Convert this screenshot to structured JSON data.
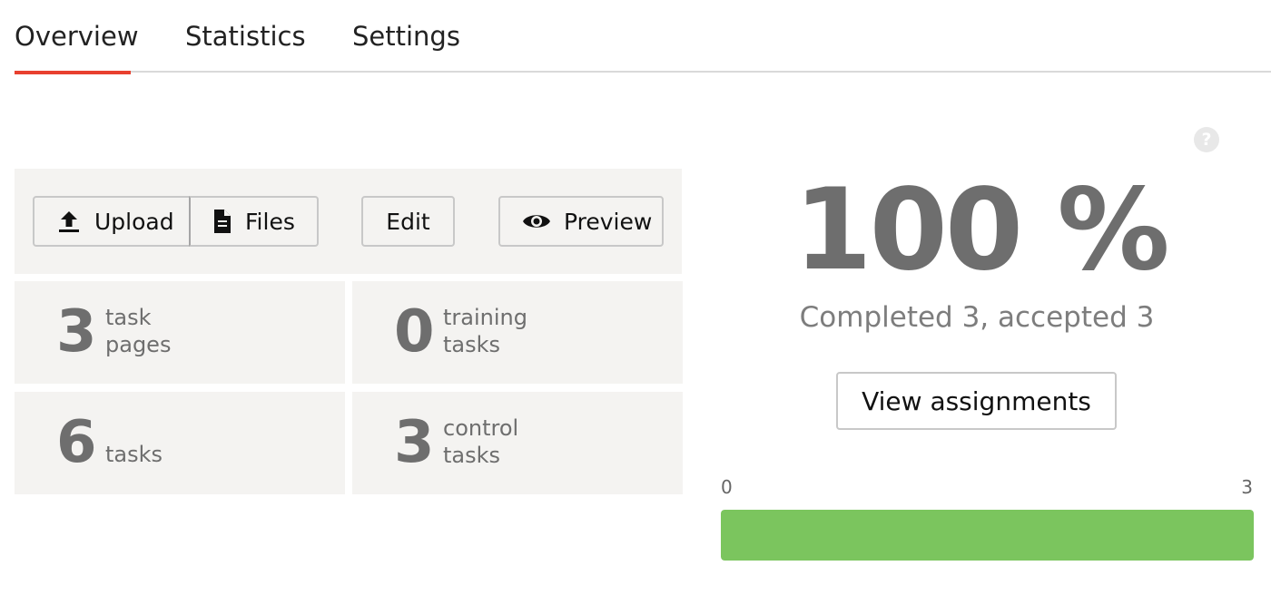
{
  "tabs": [
    {
      "label": "Overview",
      "active": true
    },
    {
      "label": "Statistics",
      "active": false
    },
    {
      "label": "Settings",
      "active": false
    }
  ],
  "toolbar": {
    "upload_label": "Upload",
    "upload_icon": "upload-icon",
    "files_label": "Files",
    "files_icon": "file-icon",
    "edit_label": "Edit",
    "preview_label": "Preview",
    "preview_icon": "eye-icon"
  },
  "stats": [
    {
      "value": "3",
      "label_line1": "task",
      "label_line2": "pages"
    },
    {
      "value": "0",
      "label_line1": "training",
      "label_line2": "tasks"
    },
    {
      "value": "6",
      "label_line1": "tasks",
      "label_line2": ""
    },
    {
      "value": "3",
      "label_line1": "control",
      "label_line2": "tasks"
    }
  ],
  "help_icon_glyph": "?",
  "summary": {
    "percent": "100 %",
    "completed_text": "Completed 3, accepted 3",
    "view_button_label": "View assignments"
  },
  "progress": {
    "min_label": "0",
    "max_label": "3",
    "value": 3,
    "max": 3,
    "fraction": 1.0,
    "color": "#7bc55e"
  },
  "colors": {
    "accent_tab": "#e8402f",
    "panel_bg": "#f4f3f1",
    "stat_text": "#6e6e6e"
  }
}
